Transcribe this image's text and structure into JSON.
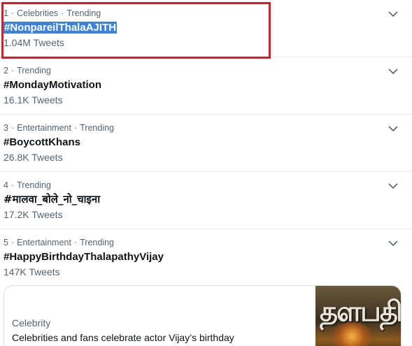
{
  "trends": [
    {
      "rank": "1",
      "context": "Celebrities",
      "status": "Trending",
      "name": "#NonpareilThalaAJITH",
      "count": "1.04M Tweets"
    },
    {
      "rank": "2",
      "context": "",
      "status": "Trending",
      "name": "#MondayMotivation",
      "count": "16.1K Tweets"
    },
    {
      "rank": "3",
      "context": "Entertainment",
      "status": "Trending",
      "name": "#BoycottKhans",
      "count": "26.8K Tweets"
    },
    {
      "rank": "4",
      "context": "",
      "status": "Trending",
      "name": "#मालवा_बोले_नो_चाइना",
      "count": "17.2K Tweets"
    },
    {
      "rank": "5",
      "context": "Entertainment",
      "status": "Trending",
      "name": "#HappyBirthdayThalapathyVijay",
      "count": "147K Tweets"
    }
  ],
  "card": {
    "category": "Celebrity",
    "headline": "Celebrities and fans celebrate actor Vijay’s birthday",
    "thumbnail_text": "தளபதி"
  },
  "colors": {
    "highlight_border": "#d0202a",
    "text_selection": "#3b82d8",
    "secondary_text": "#536471",
    "divider": "#e6ecf0"
  },
  "icons": {
    "more": "chevron-down-icon"
  }
}
